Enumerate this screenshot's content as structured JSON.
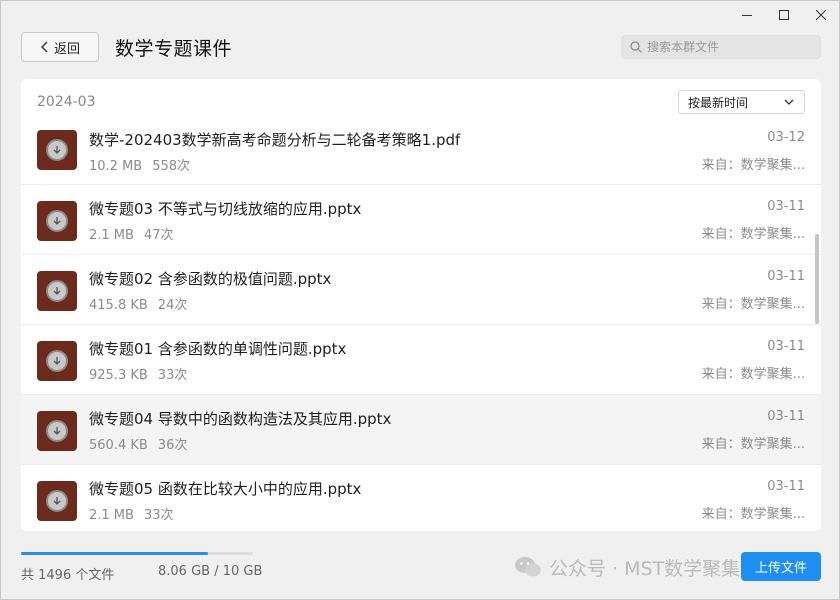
{
  "window": {
    "controls": {
      "minimize_icon": "minimize-icon",
      "maximize_icon": "maximize-icon",
      "close_icon": "close-icon"
    }
  },
  "header": {
    "back_label": "返回",
    "title": "数学专题课件",
    "search_placeholder": "搜索本群文件"
  },
  "list": {
    "month": "2024-03",
    "sort_label": "按最新时间",
    "files": [
      {
        "name": "数学-202403数学新高考命题分析与二轮备考策略1.pdf",
        "size": "10.2 MB",
        "downloads": "558次",
        "date": "03-12",
        "source": "来自：数学聚集..."
      },
      {
        "name": "微专题03 不等式与切线放缩的应用.pptx",
        "size": "2.1 MB",
        "downloads": "47次",
        "date": "03-11",
        "source": "来自：数学聚集..."
      },
      {
        "name": "微专题02 含参函数的极值问题.pptx",
        "size": "415.8 KB",
        "downloads": "24次",
        "date": "03-11",
        "source": "来自：数学聚集..."
      },
      {
        "name": "微专题01 含参函数的单调性问题.pptx",
        "size": "925.3 KB",
        "downloads": "33次",
        "date": "03-11",
        "source": "来自：数学聚集..."
      },
      {
        "name": "微专题04 导数中的函数构造法及其应用.pptx",
        "size": "560.4 KB",
        "downloads": "36次",
        "date": "03-11",
        "source": "来自：数学聚集..."
      },
      {
        "name": "微专题05 函数在比较大小中的应用.pptx",
        "size": "2.1 MB",
        "downloads": "33次",
        "date": "03-11",
        "source": "来自：数学聚集..."
      }
    ]
  },
  "footer": {
    "file_count": "共 1496 个文件",
    "quota": "8.06 GB / 10 GB",
    "storage_used_fraction": 0.806,
    "upload_label": "上传文件",
    "watermark": "公众号 · MST数学聚集地"
  },
  "colors": {
    "accent": "#1e8ef0",
    "file_icon_bg": "#6b2a1c",
    "progress": "#2b8de8"
  }
}
